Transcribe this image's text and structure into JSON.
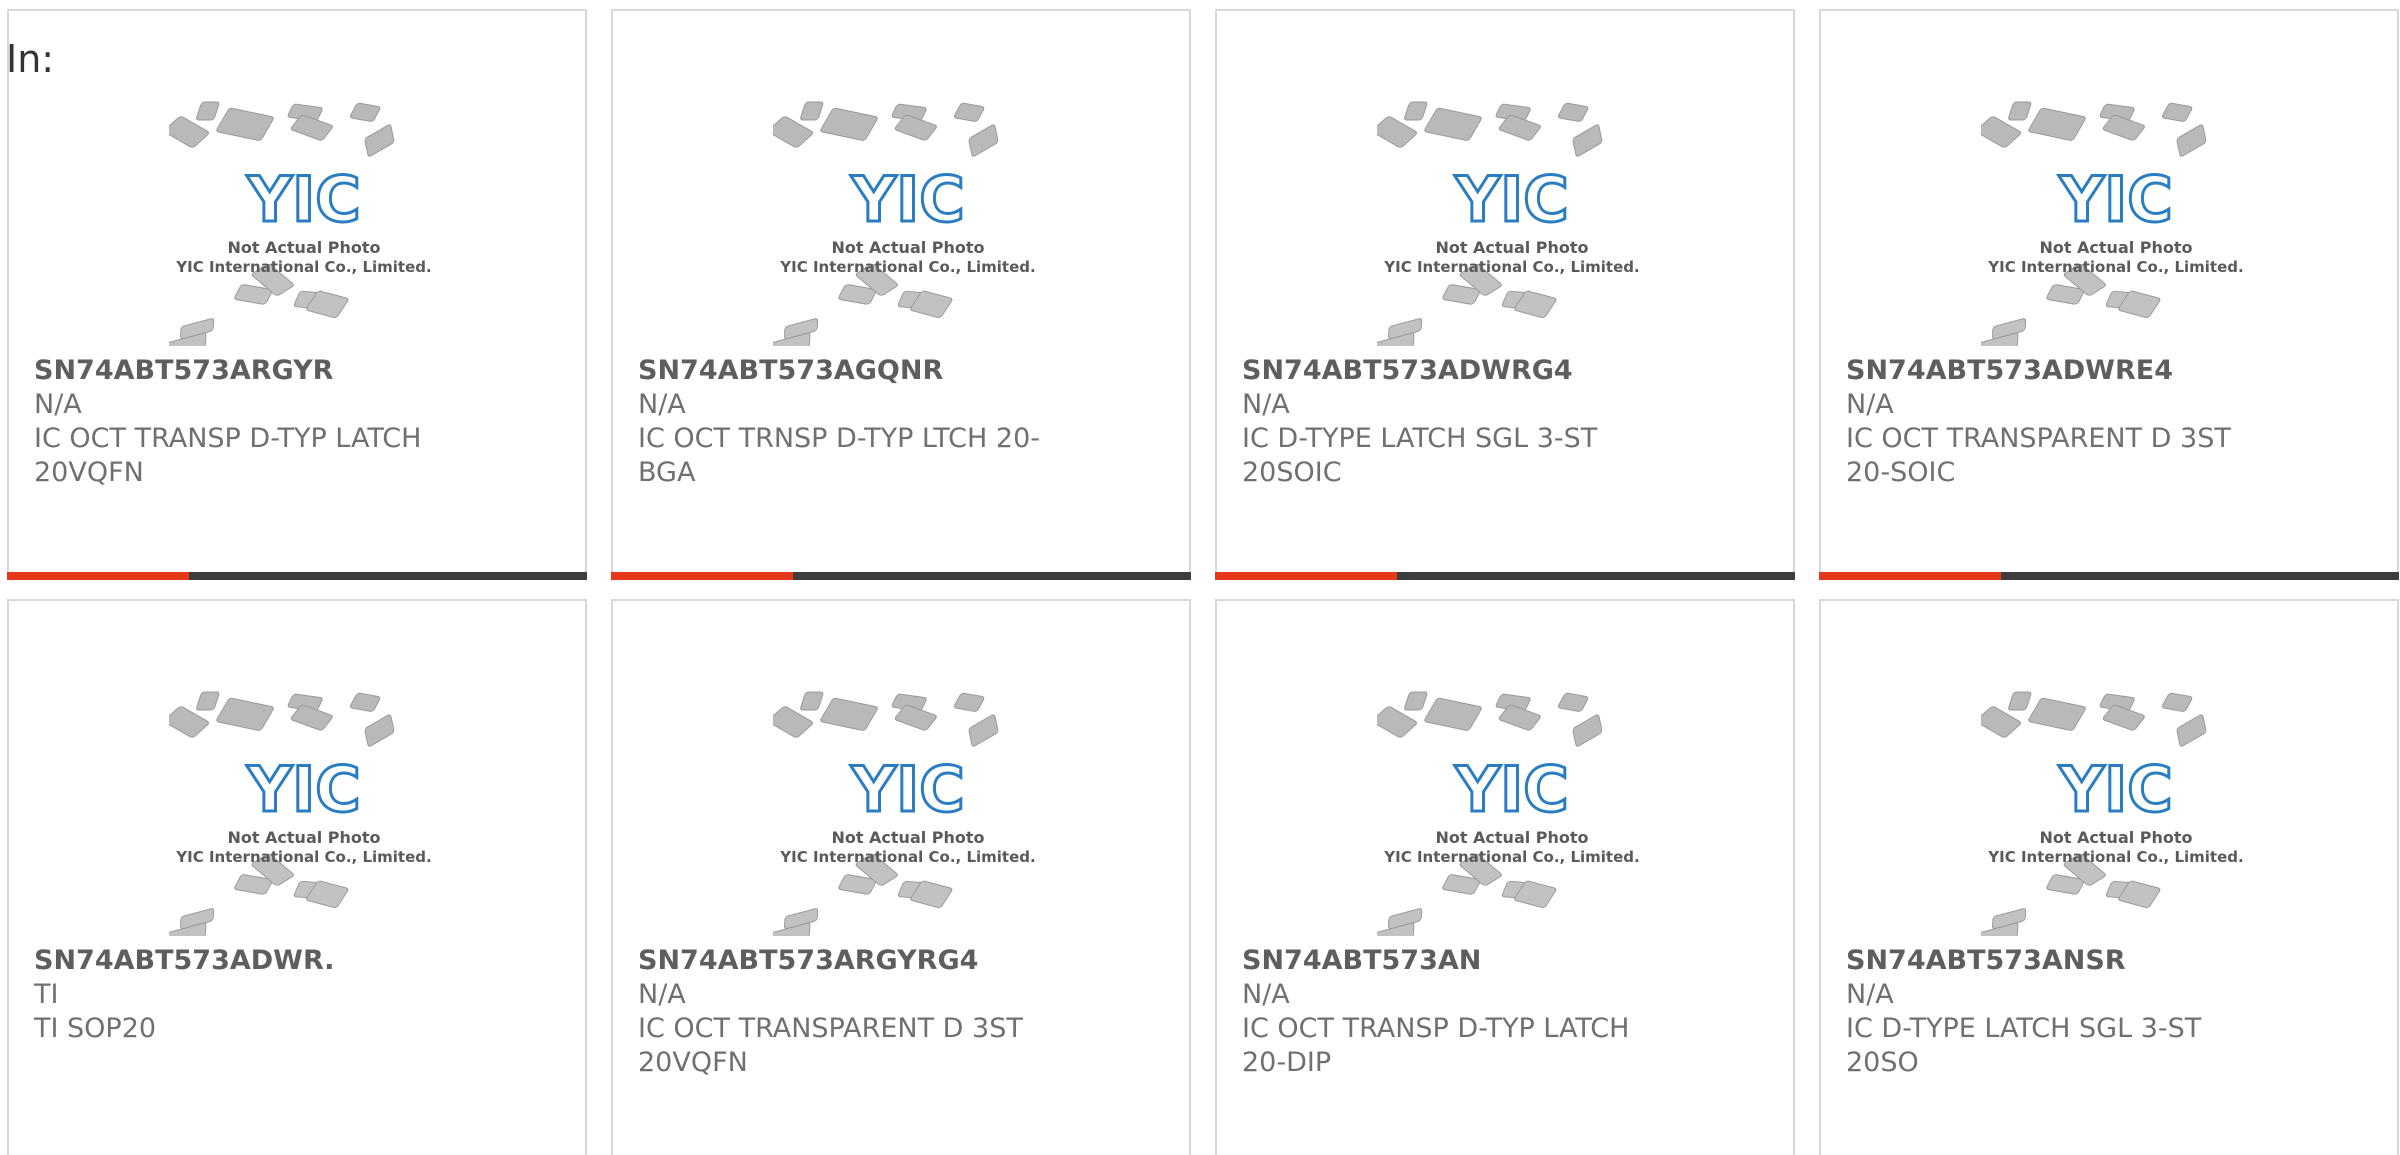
{
  "header": {
    "in_label": "In:"
  },
  "placeholder_image": {
    "line1": "Not Actual Photo",
    "line2": "YIC International Co., Limited.",
    "logo_text": "YIC"
  },
  "colors": {
    "accent": "#e8381a",
    "bar": "#3d3d3d",
    "logo": "#2a7dc1"
  },
  "products": [
    {
      "part": "SN74ABT573ARGYR",
      "maker": "N/A",
      "desc": "IC OCT TRANSP D-TYP LATCH 20VQFN"
    },
    {
      "part": "SN74ABT573AGQNR",
      "maker": "N/A",
      "desc": "IC OCT TRNSP D-TYP LTCH 20-BGA"
    },
    {
      "part": "SN74ABT573ADWRG4",
      "maker": "N/A",
      "desc": "IC D-TYPE LATCH SGL 3-ST 20SOIC"
    },
    {
      "part": "SN74ABT573ADWRE4",
      "maker": "N/A",
      "desc": "IC OCT TRANSPARENT D 3ST 20-SOIC"
    },
    {
      "part": "SN74ABT573ADWR.",
      "maker": "TI",
      "desc": "TI SOP20"
    },
    {
      "part": "SN74ABT573ARGYRG4",
      "maker": "N/A",
      "desc": "IC OCT TRANSPARENT D 3ST 20VQFN"
    },
    {
      "part": "SN74ABT573AN",
      "maker": "N/A",
      "desc": "IC OCT TRANSP D-TYP LATCH 20-DIP"
    },
    {
      "part": "SN74ABT573ANSR",
      "maker": "N/A",
      "desc": "IC D-TYPE LATCH SGL 3-ST 20SO"
    }
  ]
}
